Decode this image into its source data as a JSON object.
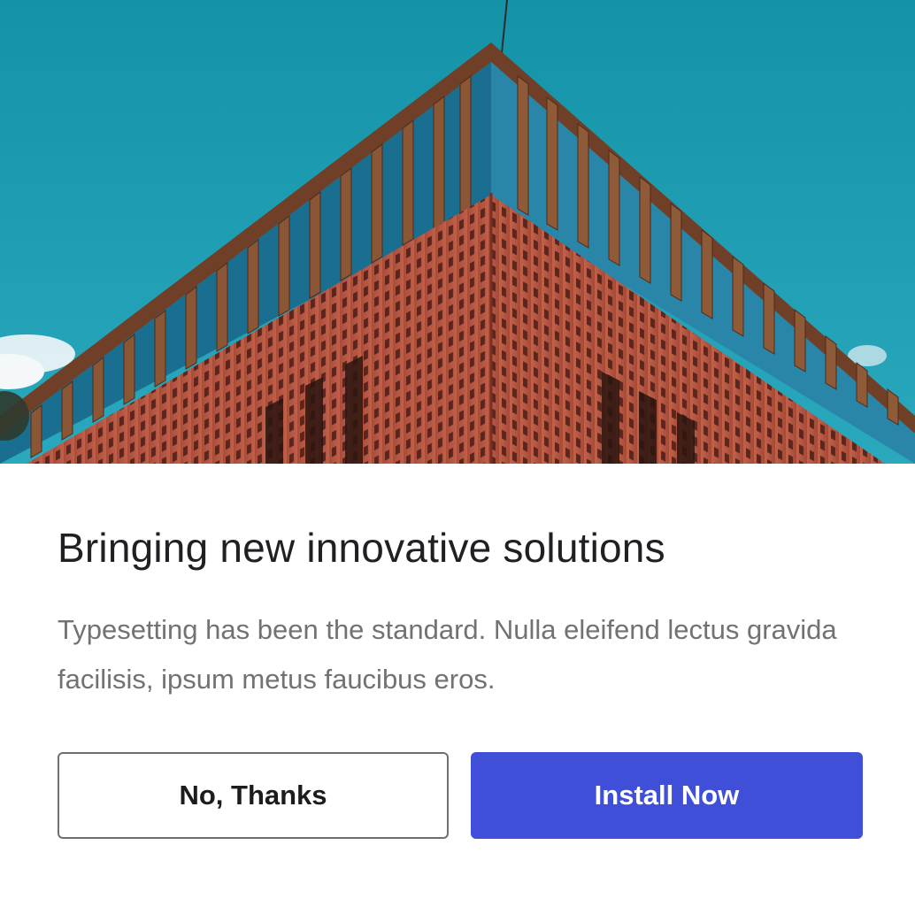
{
  "hero": {
    "image_subject": "Modern brick building corner with wooden vertical fins against a teal sky",
    "colors": {
      "sky": "#1d9db3",
      "brick": "#b85a44",
      "wood": "#8a5635"
    }
  },
  "content": {
    "title": "Bringing new innovative solutions",
    "description": "Typesetting has been the standard. Nulla eleifend lectus gravida facilisis, ipsum metus faucibus eros."
  },
  "actions": {
    "secondary_label": "No, Thanks",
    "primary_label": "Install Now",
    "primary_color": "#3f4fd8"
  }
}
